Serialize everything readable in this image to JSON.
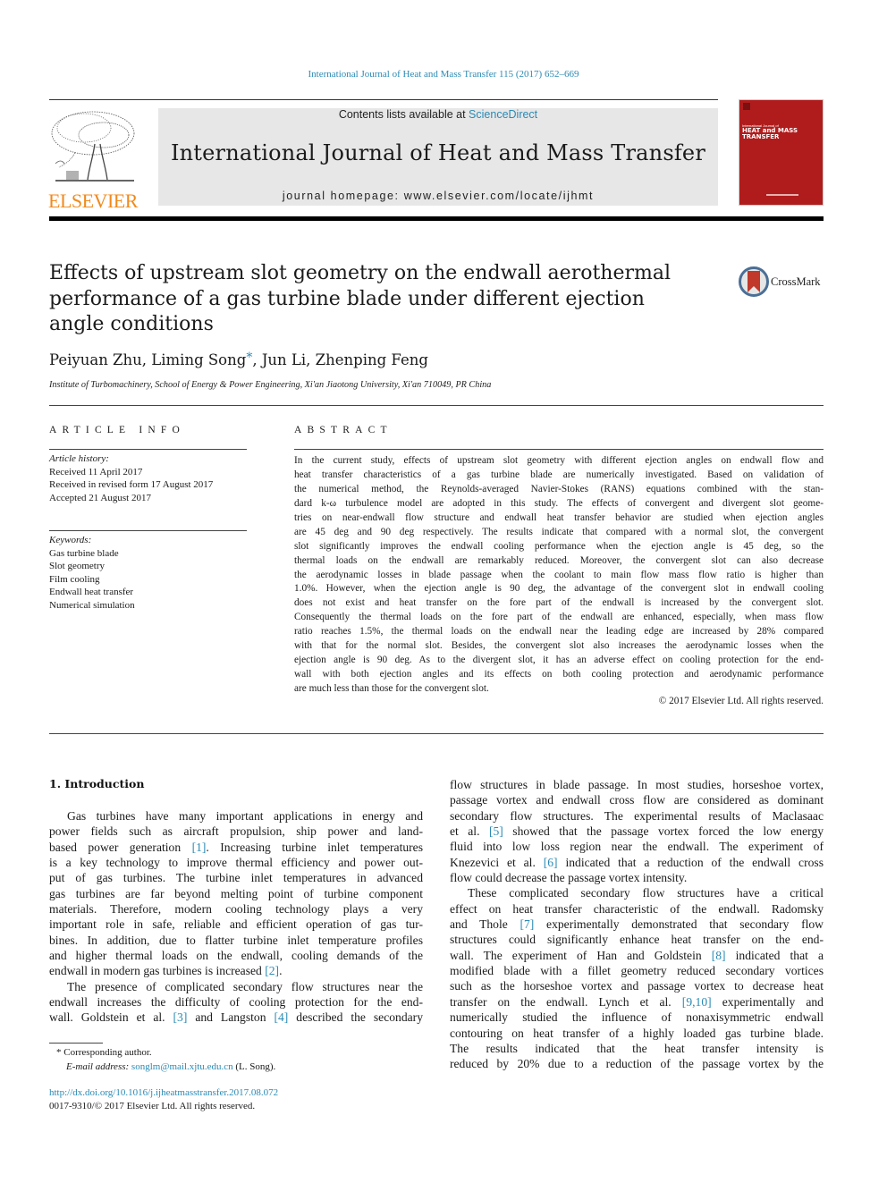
{
  "header": {
    "journal_reference": "International Journal of Heat and Mass Transfer 115 (2017) 652–669",
    "contents_prefix": "Contents lists available at ",
    "contents_link": "ScienceDirect",
    "journal_title": "International Journal of Heat and Mass Transfer",
    "homepage": "journal homepage: www.elsevier.com/locate/ijhmt",
    "publisher_wordmark": "ELSEVIER",
    "cover": {
      "small_text": "International Journal of",
      "title_lines": [
        "HEAT and MASS",
        "TRANSFER"
      ],
      "color": "#b01c1c"
    }
  },
  "article": {
    "title": "Effects of upstream slot geometry on the endwall aerothermal performance of a gas turbine blade under different ejection angle conditions",
    "crossmark_label": "CrossMark",
    "authors": [
      {
        "name": "Peiyuan Zhu",
        "corresponding": false
      },
      {
        "name": "Liming Song",
        "corresponding": true
      },
      {
        "name": "Jun Li",
        "corresponding": false
      },
      {
        "name": "Zhenping Feng",
        "corresponding": false
      }
    ],
    "corresponding_mark": "*",
    "affiliation": "Institute of Turbomachinery, School of Energy & Power Engineering, Xi'an Jiaotong University, Xi'an 710049, PR China"
  },
  "article_info": {
    "heading": "ARTICLE INFO",
    "history_label": "Article history:",
    "history": [
      "Received 11 April 2017",
      "Received in revised form 17 August 2017",
      "Accepted 21 August 2017"
    ],
    "keywords_label": "Keywords:",
    "keywords": [
      "Gas turbine blade",
      "Slot geometry",
      "Film cooling",
      "Endwall heat transfer",
      "Numerical simulation"
    ]
  },
  "abstract": {
    "heading": "ABSTRACT",
    "lines": [
      "In the current study, effects of upstream slot geometry with different ejection angles on endwall flow and",
      "heat transfer characteristics of a gas turbine blade are numerically investigated. Based on validation of",
      "the numerical method, the Reynolds-averaged Navier-Stokes (RANS) equations combined with the stan-",
      "dard k-ω turbulence model are adopted in this study. The effects of convergent and divergent slot geome-",
      "tries on near-endwall flow structure and endwall heat transfer behavior are studied when ejection angles",
      "are 45 deg and 90 deg respectively. The results indicate that compared with a normal slot, the convergent",
      "slot significantly improves the endwall cooling performance when the ejection angle is 45 deg, so the",
      "thermal loads on the endwall are remarkably reduced. Moreover, the convergent slot can also decrease",
      "the aerodynamic losses in blade passage when the coolant to main flow mass flow ratio is higher than",
      "1.0%. However, when the ejection angle is 90 deg, the advantage of the convergent slot in endwall cooling",
      "does not exist and heat transfer on the fore part of the endwall is increased by the convergent slot.",
      "Consequently the thermal loads on the fore part of the endwall are enhanced, especially, when mass flow",
      "ratio reaches 1.5%, the thermal loads on the endwall near the leading edge are increased by 28% compared",
      "with that for the normal slot. Besides, the convergent slot also increases the aerodynamic losses when the",
      "ejection angle is 90 deg. As to the divergent slot, it has an adverse effect on cooling protection for the end-",
      "wall with both ejection angles and its effects on both cooling protection and aerodynamic performance",
      "are much less than those for the convergent slot."
    ],
    "copyright": "© 2017 Elsevier Ltd. All rights reserved."
  },
  "body": {
    "section_heading": "1. Introduction",
    "left_column": [
      {
        "segments": [
          {
            "t": "Gas turbines have many important applications in energy and"
          }
        ],
        "indent": true
      },
      {
        "segments": [
          {
            "t": "power fields such as aircraft propulsion, ship power and land-"
          }
        ]
      },
      {
        "segments": [
          {
            "t": "based power generation "
          },
          {
            "t": "[1]",
            "ref": true
          },
          {
            "t": ". Increasing turbine inlet temperatures"
          }
        ]
      },
      {
        "segments": [
          {
            "t": "is a key technology to improve thermal efficiency and power out-"
          }
        ]
      },
      {
        "segments": [
          {
            "t": "put of gas turbines. The turbine inlet temperatures in advanced"
          }
        ]
      },
      {
        "segments": [
          {
            "t": "gas turbines are far beyond melting point of turbine component"
          }
        ]
      },
      {
        "segments": [
          {
            "t": "materials. Therefore, modern cooling technology plays a very"
          }
        ]
      },
      {
        "segments": [
          {
            "t": "important role in safe, reliable and efficient operation of gas tur-"
          }
        ]
      },
      {
        "segments": [
          {
            "t": "bines. In addition, due to flatter turbine inlet temperature profiles"
          }
        ]
      },
      {
        "segments": [
          {
            "t": "and higher thermal loads on the endwall, cooling demands of the"
          }
        ]
      },
      {
        "segments": [
          {
            "t": "endwall in modern gas turbines is increased "
          },
          {
            "t": "[2]",
            "ref": true
          },
          {
            "t": "."
          }
        ],
        "last": true
      },
      {
        "segments": [
          {
            "t": "The presence of complicated secondary flow structures near the"
          }
        ],
        "indent": true
      },
      {
        "segments": [
          {
            "t": "endwall increases the difficulty of cooling protection for the end-"
          }
        ]
      },
      {
        "segments": [
          {
            "t": "wall. Goldstein et al. "
          },
          {
            "t": "[3]",
            "ref": true
          },
          {
            "t": " and Langston "
          },
          {
            "t": "[4]",
            "ref": true
          },
          {
            "t": " described the secondary"
          }
        ]
      }
    ],
    "right_column": [
      {
        "segments": [
          {
            "t": "flow structures in blade passage. In most studies, horseshoe vortex,"
          }
        ]
      },
      {
        "segments": [
          {
            "t": "passage vortex and endwall cross flow are considered as dominant"
          }
        ]
      },
      {
        "segments": [
          {
            "t": "secondary flow structures. The experimental results of Maclasaac"
          }
        ]
      },
      {
        "segments": [
          {
            "t": "et al. "
          },
          {
            "t": "[5]",
            "ref": true
          },
          {
            "t": " showed that the passage vortex forced the low energy"
          }
        ]
      },
      {
        "segments": [
          {
            "t": "fluid into low loss region near the endwall. The experiment of"
          }
        ]
      },
      {
        "segments": [
          {
            "t": "Knezevici et al. "
          },
          {
            "t": "[6]",
            "ref": true
          },
          {
            "t": " indicated that a reduction of the endwall cross"
          }
        ]
      },
      {
        "segments": [
          {
            "t": "flow could decrease the passage vortex intensity."
          }
        ],
        "last": true
      },
      {
        "segments": [
          {
            "t": "These complicated secondary flow structures have a critical"
          }
        ],
        "indent": true
      },
      {
        "segments": [
          {
            "t": "effect on heat transfer characteristic of the endwall. Radomsky"
          }
        ]
      },
      {
        "segments": [
          {
            "t": "and Thole "
          },
          {
            "t": "[7]",
            "ref": true
          },
          {
            "t": " experimentally demonstrated that secondary flow"
          }
        ]
      },
      {
        "segments": [
          {
            "t": "structures could significantly enhance heat transfer on the end-"
          }
        ]
      },
      {
        "segments": [
          {
            "t": "wall. The experiment of Han and Goldstein "
          },
          {
            "t": "[8]",
            "ref": true
          },
          {
            "t": " indicated that a"
          }
        ]
      },
      {
        "segments": [
          {
            "t": "modified blade with a fillet geometry reduced secondary vortices"
          }
        ]
      },
      {
        "segments": [
          {
            "t": "such as the horseshoe vortex and passage vortex to decrease heat"
          }
        ]
      },
      {
        "segments": [
          {
            "t": "transfer on the endwall. Lynch et al. "
          },
          {
            "t": "[9,10]",
            "ref": true
          },
          {
            "t": " experimentally and"
          }
        ]
      },
      {
        "segments": [
          {
            "t": "numerically studied the influence of nonaxisymmetric endwall"
          }
        ]
      },
      {
        "segments": [
          {
            "t": "contouring on heat transfer of a highly loaded gas turbine blade."
          }
        ]
      },
      {
        "segments": [
          {
            "t": "The results indicated that the heat transfer intensity is"
          }
        ]
      },
      {
        "segments": [
          {
            "t": "reduced by 20% due to a reduction of the passage vortex by the"
          }
        ]
      }
    ]
  },
  "footnotes": {
    "corresponding_mark": "*",
    "corresponding_text": " Corresponding author.",
    "email_label": "E-mail address: ",
    "email": "songlm@mail.xjtu.edu.cn",
    "email_suffix": " (L. Song).",
    "doi": "http://dx.doi.org/10.1016/j.ijheatmasstransfer.2017.08.072",
    "issn_copyright": "0017-9310/© 2017 Elsevier Ltd. All rights reserved."
  },
  "colors": {
    "link": "#2a8ab4",
    "publisher_orange": "#f08a1c",
    "banner_gray": "#e7e7e7",
    "cover_red": "#b01c1c"
  }
}
